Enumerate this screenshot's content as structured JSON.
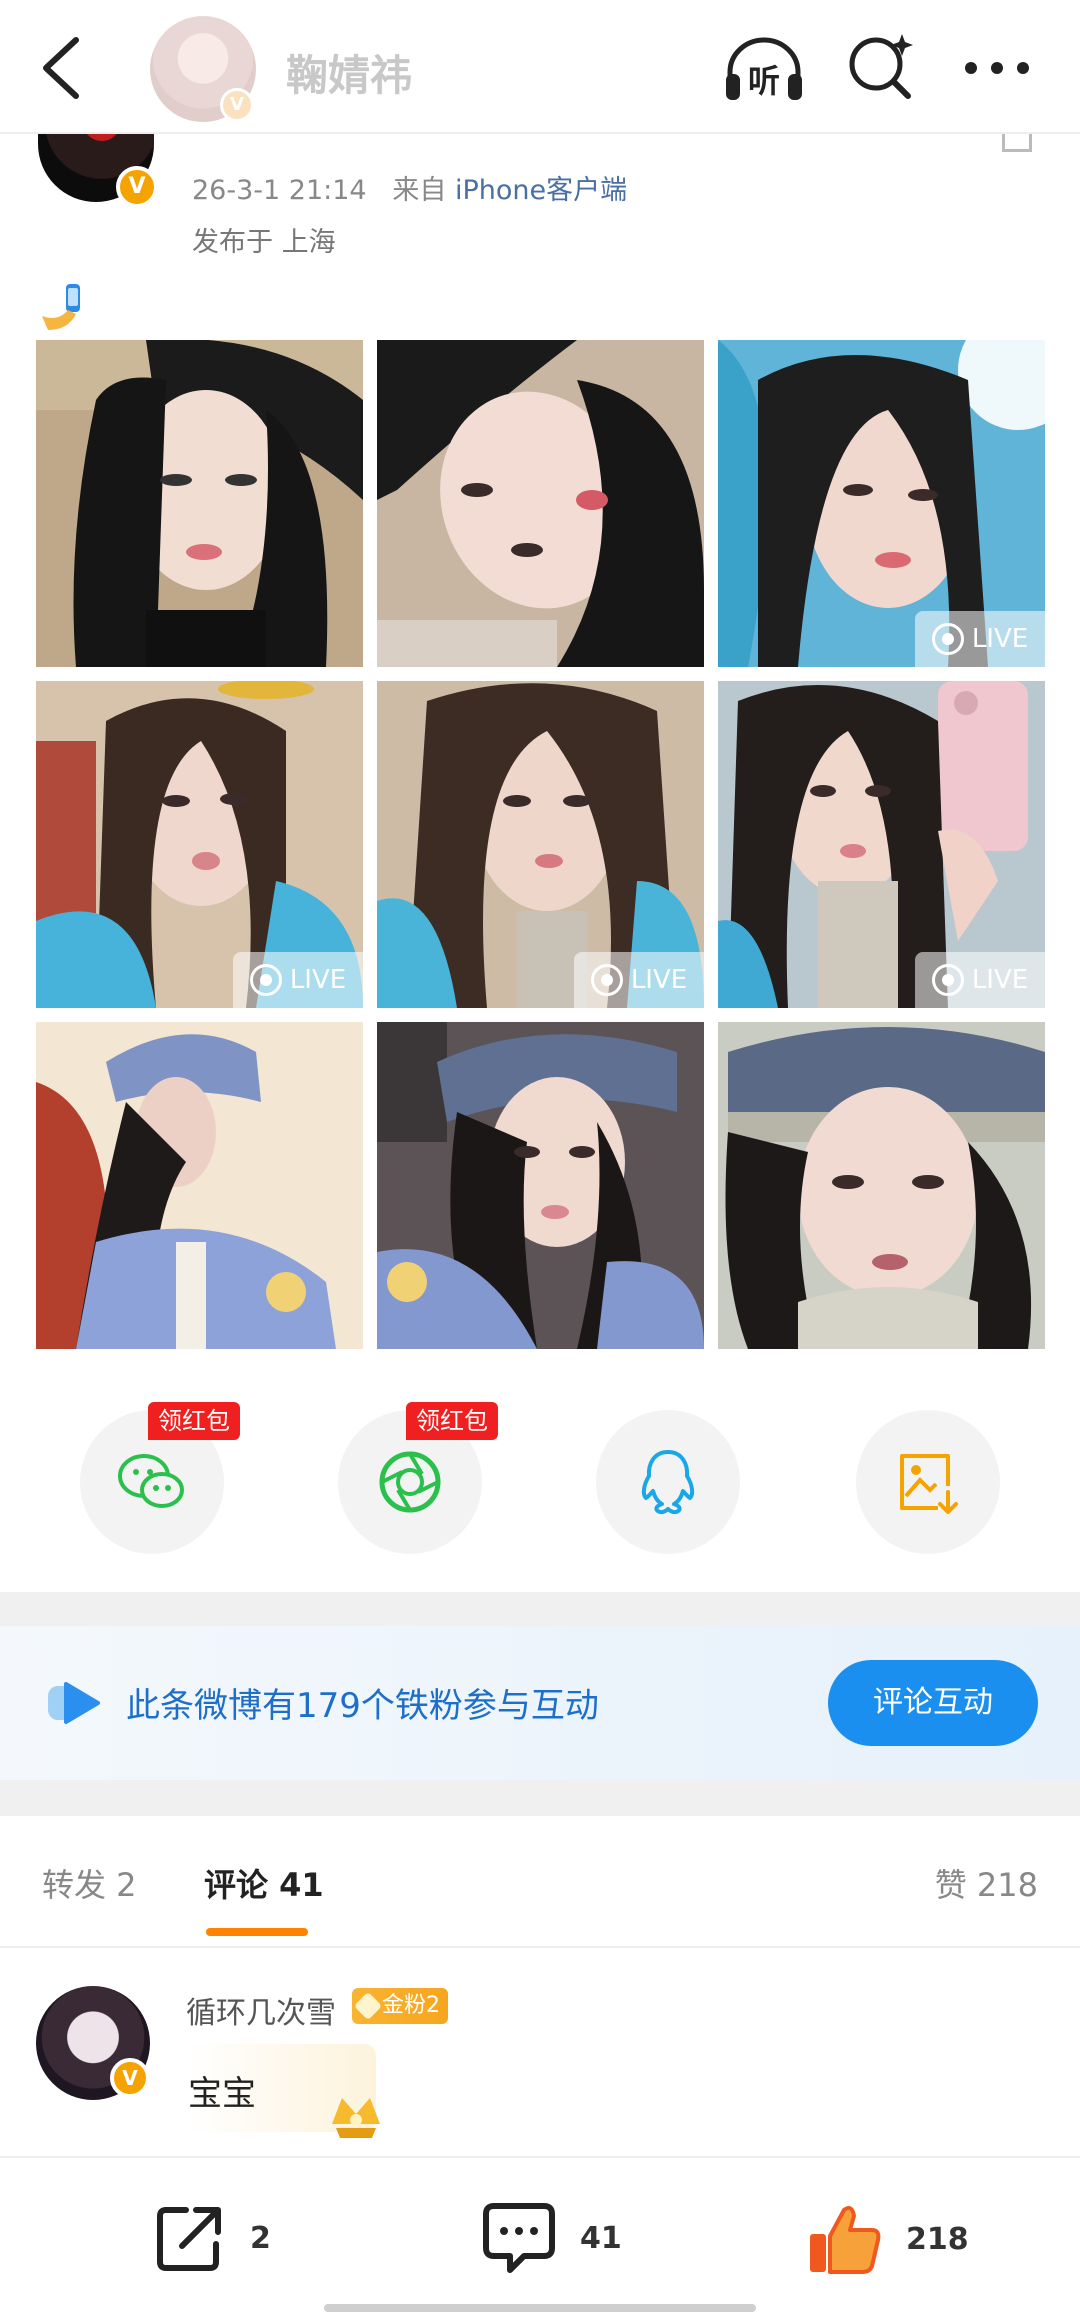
{
  "nav": {
    "author_name": "鞠婧祎",
    "listen_label": "听",
    "verified_badge": "V"
  },
  "post": {
    "time": "26-3-1 21:14",
    "source_prefix": "来自",
    "source": "iPhone客户端",
    "location": "发布于 上海",
    "emoji": "selfie-hand-emoji",
    "photos": [
      {
        "live": false,
        "live_label": ""
      },
      {
        "live": false,
        "live_label": ""
      },
      {
        "live": true,
        "live_label": "LIVE"
      },
      {
        "live": true,
        "live_label": "LIVE"
      },
      {
        "live": true,
        "live_label": "LIVE"
      },
      {
        "live": true,
        "live_label": "LIVE"
      },
      {
        "live": false,
        "live_label": ""
      },
      {
        "live": false,
        "live_label": ""
      },
      {
        "live": false,
        "live_label": ""
      }
    ]
  },
  "share": {
    "wechat_tag": "领红包",
    "moments_tag": "领红包"
  },
  "banner": {
    "text": "此条微博有179个铁粉参与互动",
    "button": "评论互动"
  },
  "tabs": {
    "repost": "转发 2",
    "comment": "评论 41",
    "like": "赞 218"
  },
  "comment": {
    "user": "循环几次雪",
    "badge": "金粉2",
    "text": "宝宝",
    "verified_badge": "V"
  },
  "bottom": {
    "repost_count": "2",
    "comment_count": "41",
    "like_count": "218"
  },
  "colors": {
    "accent_orange": "#ff8200",
    "link_blue": "#1d6fc9",
    "button_blue": "#1b8ff0",
    "redpacket_red": "#f02020"
  }
}
